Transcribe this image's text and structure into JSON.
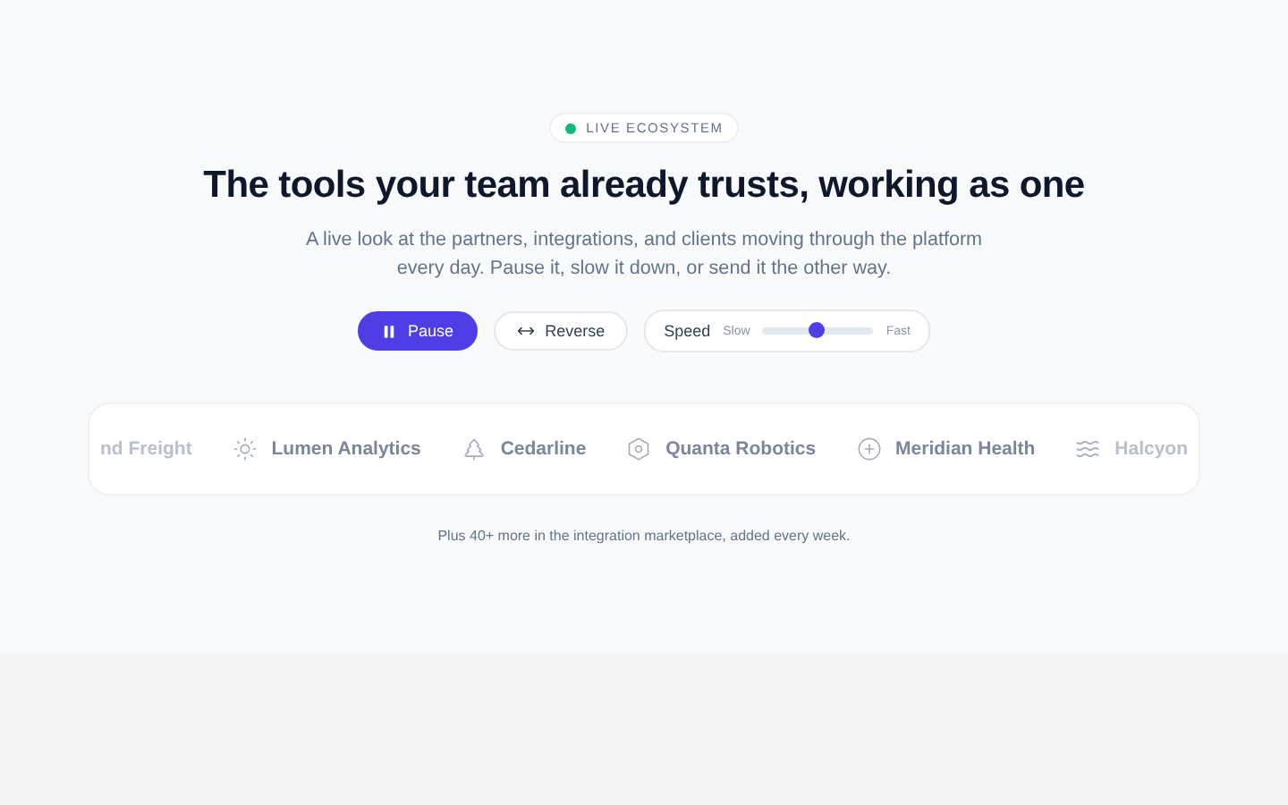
{
  "badge": {
    "label": "LIVE ECOSYSTEM",
    "live": true
  },
  "heading": "The tools your team already trusts, working as one",
  "subtitle": "A live look at the partners, integrations, and clients moving through the platform every day. Pause it, slow it down, or send it the other way.",
  "controls": {
    "pause": {
      "label": "Pause",
      "selected": true
    },
    "reverse": {
      "label": "Reverse",
      "selected": false
    },
    "speed": {
      "label": "Speed",
      "min_label": "Slow",
      "max_label": "Fast",
      "level": 0.49
    }
  },
  "partners": [
    {
      "name": "nd Freight",
      "kind": "none"
    },
    {
      "name": "Lumen Analytics",
      "kind": "sun"
    },
    {
      "name": "Cedarline",
      "kind": "tree"
    },
    {
      "name": "Quanta Robotics",
      "kind": "hexagon"
    },
    {
      "name": "Meridian Health",
      "kind": "plus"
    },
    {
      "name": "Halcyon",
      "kind": "waves"
    }
  ],
  "footnote": "Plus 40+ more in the integration marketplace, added every week."
}
